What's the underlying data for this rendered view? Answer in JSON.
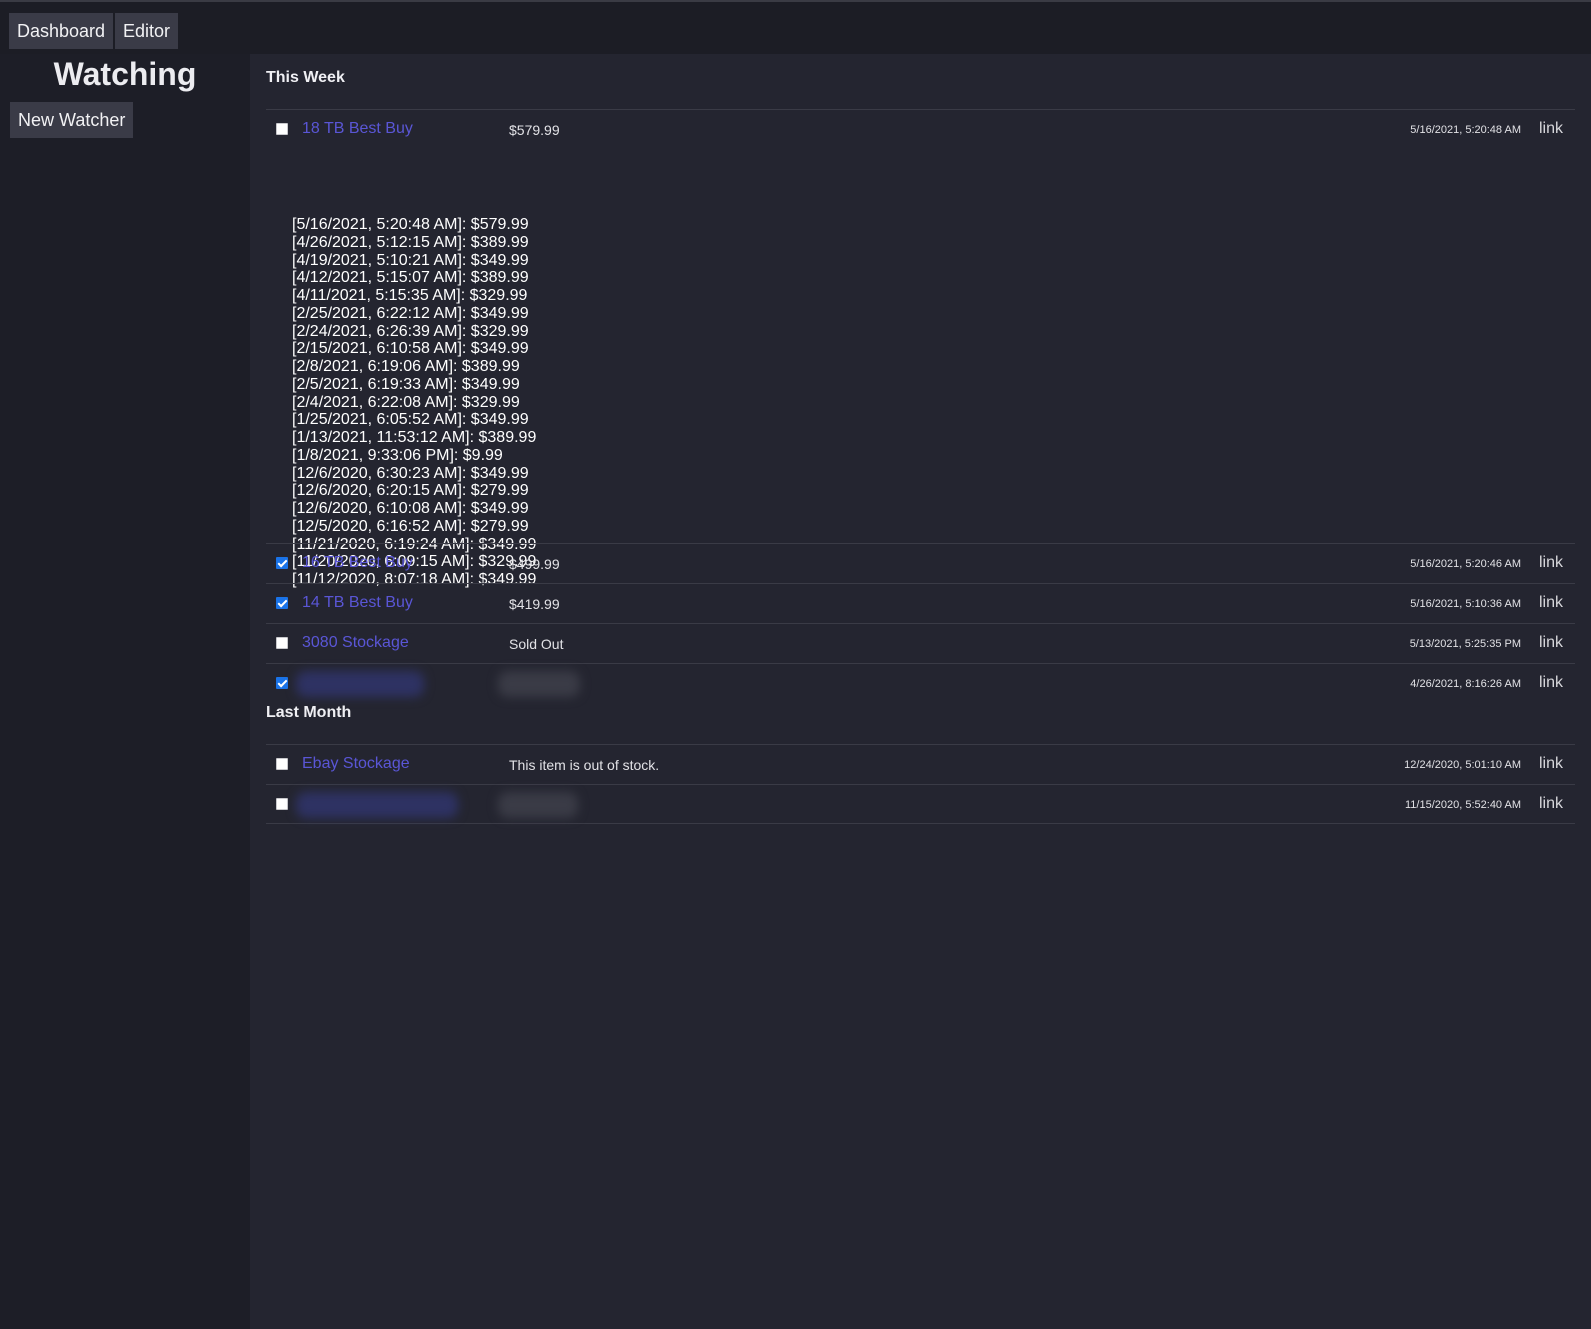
{
  "nav": {
    "dashboard_label": "Dashboard",
    "editor_label": "Editor"
  },
  "sidebar": {
    "title": "Watching",
    "new_watcher_label": "New Watcher"
  },
  "sections": [
    {
      "title": "This Week",
      "items": [
        {
          "name": "18 TB Best Buy",
          "price": "$579.99",
          "time": "5/16/2021, 5:20:48 AM",
          "link": "link",
          "checked": false,
          "history": [
            "[5/16/2021, 5:20:48 AM]: $579.99",
            "[4/26/2021, 5:12:15 AM]: $389.99",
            "[4/19/2021, 5:10:21 AM]: $349.99",
            "[4/12/2021, 5:15:07 AM]: $389.99",
            "[4/11/2021, 5:15:35 AM]: $329.99",
            "[2/25/2021, 6:22:12 AM]: $349.99",
            "[2/24/2021, 6:26:39 AM]: $329.99",
            "[2/15/2021, 6:10:58 AM]: $349.99",
            "[2/8/2021, 6:19:06 AM]: $389.99",
            "[2/5/2021, 6:19:33 AM]: $349.99",
            "[2/4/2021, 6:22:08 AM]: $329.99",
            "[1/25/2021, 6:05:52 AM]: $349.99",
            "[1/13/2021, 11:53:12 AM]: $389.99",
            "[1/8/2021, 9:33:06 PM]: $9.99",
            "[12/6/2020, 6:30:23 AM]: $349.99",
            "[12/6/2020, 6:20:15 AM]: $279.99",
            "[12/6/2020, 6:10:08 AM]: $349.99",
            "[12/5/2020, 6:16:52 AM]: $279.99",
            "[11/21/2020, 6:19:24 AM]: $349.99",
            "[11/20/2020, 6:09:15 AM]: $329.99",
            "[11/12/2020, 8:07:18 AM]: $349.99"
          ]
        },
        {
          "name": "16 TB Best Buy",
          "price": "$499.99",
          "time": "5/16/2021, 5:20:46 AM",
          "link": "link",
          "checked": true
        },
        {
          "name": "14 TB Best Buy",
          "price": "$419.99",
          "time": "5/16/2021, 5:10:36 AM",
          "link": "link",
          "checked": true
        },
        {
          "name": "3080 Stockage",
          "price": "Sold Out",
          "time": "5/13/2021, 5:25:35 PM",
          "link": "link",
          "checked": false
        },
        {
          "name": "",
          "price": "",
          "time": "4/26/2021, 8:16:26 AM",
          "link": "link",
          "checked": true,
          "redacted": true
        }
      ]
    },
    {
      "title": "Last Month",
      "items": [
        {
          "name": "Ebay Stockage",
          "price": "This item is out of stock.",
          "time": "12/24/2020, 5:01:10 AM",
          "link": "link",
          "checked": false
        },
        {
          "name": "",
          "price": "",
          "time": "11/15/2020, 5:52:40 AM",
          "link": "link",
          "checked": false,
          "redacted": true
        }
      ]
    }
  ],
  "colors": {
    "background": "#1d1e27",
    "main_panel": "#242530",
    "item_link": "#5a56d6",
    "checkbox_checked": "#1a73e8"
  }
}
